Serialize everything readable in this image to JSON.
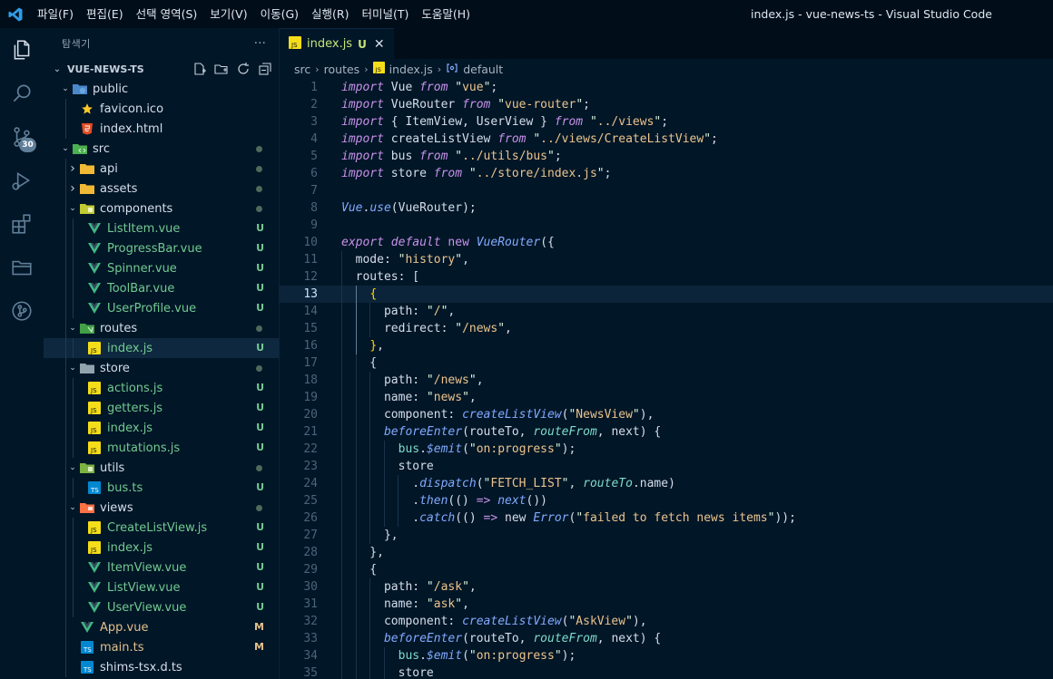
{
  "titlebar": {
    "menu": [
      "파일(F)",
      "편집(E)",
      "선택 영역(S)",
      "보기(V)",
      "이동(G)",
      "실행(R)",
      "터미널(T)",
      "도움말(H)"
    ],
    "window_title": "index.js - vue-news-ts - Visual Studio Code"
  },
  "activity": {
    "scm_badge": "30"
  },
  "explorer": {
    "header": "탐색기",
    "more": "···",
    "root": "VUE-NEWS-TS",
    "items": [
      {
        "label": "public",
        "depth": 1,
        "kind": "folder-open",
        "icon": "folder-public-icon",
        "status": "",
        "dot": false
      },
      {
        "label": "favicon.ico",
        "depth": 2,
        "kind": "file",
        "icon": "star-icon",
        "status": "",
        "dot": false
      },
      {
        "label": "index.html",
        "depth": 2,
        "kind": "file",
        "icon": "html-file-icon",
        "status": "",
        "dot": false
      },
      {
        "label": "src",
        "depth": 1,
        "kind": "folder-open",
        "icon": "folder-src-icon",
        "status": "",
        "dot": true
      },
      {
        "label": "api",
        "depth": 2,
        "kind": "folder-closed",
        "icon": "folder-icon",
        "status": "",
        "dot": true
      },
      {
        "label": "assets",
        "depth": 2,
        "kind": "folder-closed",
        "icon": "folder-icon",
        "status": "",
        "dot": true
      },
      {
        "label": "components",
        "depth": 2,
        "kind": "folder-open",
        "icon": "folder-components-icon",
        "status": "",
        "dot": true
      },
      {
        "label": "ListItem.vue",
        "depth": 3,
        "kind": "file",
        "icon": "vue-file-icon",
        "status": "U",
        "dot": false
      },
      {
        "label": "ProgressBar.vue",
        "depth": 3,
        "kind": "file",
        "icon": "vue-file-icon",
        "status": "U",
        "dot": false
      },
      {
        "label": "Spinner.vue",
        "depth": 3,
        "kind": "file",
        "icon": "vue-file-icon",
        "status": "U",
        "dot": false
      },
      {
        "label": "ToolBar.vue",
        "depth": 3,
        "kind": "file",
        "icon": "vue-file-icon",
        "status": "U",
        "dot": false
      },
      {
        "label": "UserProfile.vue",
        "depth": 3,
        "kind": "file",
        "icon": "vue-file-icon",
        "status": "U",
        "dot": false
      },
      {
        "label": "routes",
        "depth": 2,
        "kind": "folder-open",
        "icon": "folder-routes-icon",
        "status": "",
        "dot": true
      },
      {
        "label": "index.js",
        "depth": 3,
        "kind": "file",
        "icon": "js-file-icon",
        "status": "U",
        "dot": false,
        "active": true
      },
      {
        "label": "store",
        "depth": 2,
        "kind": "folder-open",
        "icon": "folder-store-icon",
        "status": "",
        "dot": true
      },
      {
        "label": "actions.js",
        "depth": 3,
        "kind": "file",
        "icon": "js-file-icon",
        "status": "U",
        "dot": false
      },
      {
        "label": "getters.js",
        "depth": 3,
        "kind": "file",
        "icon": "js-file-icon",
        "status": "U",
        "dot": false
      },
      {
        "label": "index.js",
        "depth": 3,
        "kind": "file",
        "icon": "js-file-icon",
        "status": "U",
        "dot": false
      },
      {
        "label": "mutations.js",
        "depth": 3,
        "kind": "file",
        "icon": "js-file-icon",
        "status": "U",
        "dot": false
      },
      {
        "label": "utils",
        "depth": 2,
        "kind": "folder-open",
        "icon": "folder-utils-icon",
        "status": "",
        "dot": true
      },
      {
        "label": "bus.ts",
        "depth": 3,
        "kind": "file",
        "icon": "ts-file-icon",
        "status": "U",
        "dot": false
      },
      {
        "label": "views",
        "depth": 2,
        "kind": "folder-open",
        "icon": "folder-views-icon",
        "status": "",
        "dot": true
      },
      {
        "label": "CreateListView.js",
        "depth": 3,
        "kind": "file",
        "icon": "js-file-icon",
        "status": "U",
        "dot": false
      },
      {
        "label": "index.js",
        "depth": 3,
        "kind": "file",
        "icon": "js-file-icon",
        "status": "U",
        "dot": false
      },
      {
        "label": "ItemView.vue",
        "depth": 3,
        "kind": "file",
        "icon": "vue-file-icon",
        "status": "U",
        "dot": false
      },
      {
        "label": "ListView.vue",
        "depth": 3,
        "kind": "file",
        "icon": "vue-file-icon",
        "status": "U",
        "dot": false
      },
      {
        "label": "UserView.vue",
        "depth": 3,
        "kind": "file",
        "icon": "vue-file-icon",
        "status": "U",
        "dot": false
      },
      {
        "label": "App.vue",
        "depth": 2,
        "kind": "file",
        "icon": "vue-file-icon",
        "status": "M",
        "dot": false
      },
      {
        "label": "main.ts",
        "depth": 2,
        "kind": "file",
        "icon": "ts-file-icon",
        "status": "M",
        "dot": false
      },
      {
        "label": "shims-tsx.d.ts",
        "depth": 2,
        "kind": "file",
        "icon": "ts-file-icon",
        "status": "",
        "dot": false
      }
    ]
  },
  "editor": {
    "tab": {
      "label": "index.js",
      "status": "U",
      "close": "✕"
    },
    "breadcrumb": [
      "src",
      "routes",
      "index.js",
      "default"
    ],
    "current_line": 13,
    "lines": [
      [
        [
          "k",
          "import"
        ],
        [
          "v",
          " Vue "
        ],
        [
          "k",
          "from"
        ],
        [
          "v",
          " "
        ],
        [
          "q",
          "\""
        ],
        [
          "s",
          "vue"
        ],
        [
          "q",
          "\""
        ],
        [
          "v",
          ";"
        ]
      ],
      [
        [
          "k",
          "import"
        ],
        [
          "v",
          " VueRouter "
        ],
        [
          "k",
          "from"
        ],
        [
          "v",
          " "
        ],
        [
          "q",
          "\""
        ],
        [
          "s",
          "vue-router"
        ],
        [
          "q",
          "\""
        ],
        [
          "v",
          ";"
        ]
      ],
      [
        [
          "k",
          "import"
        ],
        [
          "v",
          " { ItemView, UserView } "
        ],
        [
          "k",
          "from"
        ],
        [
          "v",
          " "
        ],
        [
          "q",
          "\""
        ],
        [
          "s",
          "../views"
        ],
        [
          "q",
          "\""
        ],
        [
          "v",
          ";"
        ]
      ],
      [
        [
          "k",
          "import"
        ],
        [
          "v",
          " createListView "
        ],
        [
          "k",
          "from"
        ],
        [
          "v",
          " "
        ],
        [
          "q",
          "\""
        ],
        [
          "s",
          "../views/CreateListView"
        ],
        [
          "q",
          "\""
        ],
        [
          "v",
          ";"
        ]
      ],
      [
        [
          "k",
          "import"
        ],
        [
          "v",
          " bus "
        ],
        [
          "k",
          "from"
        ],
        [
          "v",
          " "
        ],
        [
          "q",
          "\""
        ],
        [
          "s",
          "../utils/bus"
        ],
        [
          "q",
          "\""
        ],
        [
          "v",
          ";"
        ]
      ],
      [
        [
          "k",
          "import"
        ],
        [
          "v",
          " store "
        ],
        [
          "k",
          "from"
        ],
        [
          "v",
          " "
        ],
        [
          "q",
          "\""
        ],
        [
          "s",
          "../store/index.js"
        ],
        [
          "q",
          "\""
        ],
        [
          "v",
          ";"
        ]
      ],
      [],
      [
        [
          "it",
          "Vue"
        ],
        [
          "v",
          "."
        ],
        [
          "f",
          "use"
        ],
        [
          "v",
          "(VueRouter);"
        ]
      ],
      [],
      [
        [
          "k",
          "export"
        ],
        [
          "v",
          " "
        ],
        [
          "k",
          "default"
        ],
        [
          "v",
          " "
        ],
        [
          "kk",
          "new"
        ],
        [
          "v",
          " "
        ],
        [
          "f",
          "VueRouter"
        ],
        [
          "v",
          "({"
        ]
      ],
      [
        [
          "v",
          "  mode: "
        ],
        [
          "q",
          "\""
        ],
        [
          "s",
          "history"
        ],
        [
          "q",
          "\""
        ],
        [
          "v",
          ","
        ]
      ],
      [
        [
          "v",
          "  routes: ["
        ]
      ],
      [
        [
          "v",
          "    "
        ],
        [
          "b",
          "{"
        ]
      ],
      [
        [
          "v",
          "      path: "
        ],
        [
          "q",
          "\""
        ],
        [
          "s",
          "/"
        ],
        [
          "q",
          "\""
        ],
        [
          "v",
          ","
        ]
      ],
      [
        [
          "v",
          "      redirect: "
        ],
        [
          "q",
          "\""
        ],
        [
          "s",
          "/news"
        ],
        [
          "q",
          "\""
        ],
        [
          "v",
          ","
        ]
      ],
      [
        [
          "v",
          "    "
        ],
        [
          "b",
          "}"
        ],
        [
          "v",
          ","
        ]
      ],
      [
        [
          "v",
          "    {"
        ]
      ],
      [
        [
          "v",
          "      path: "
        ],
        [
          "q",
          "\""
        ],
        [
          "s",
          "/news"
        ],
        [
          "q",
          "\""
        ],
        [
          "v",
          ","
        ]
      ],
      [
        [
          "v",
          "      name: "
        ],
        [
          "q",
          "\""
        ],
        [
          "s",
          "news"
        ],
        [
          "q",
          "\""
        ],
        [
          "v",
          ","
        ]
      ],
      [
        [
          "v",
          "      component: "
        ],
        [
          "f",
          "createListView"
        ],
        [
          "v",
          "("
        ],
        [
          "q",
          "\""
        ],
        [
          "s",
          "NewsView"
        ],
        [
          "q",
          "\""
        ],
        [
          "v",
          "),"
        ]
      ],
      [
        [
          "v",
          "      "
        ],
        [
          "f",
          "beforeEnter"
        ],
        [
          "v",
          "(routeTo, "
        ],
        [
          "vi",
          "routeFrom"
        ],
        [
          "v",
          ", next) {"
        ]
      ],
      [
        [
          "v",
          "        "
        ],
        [
          "p",
          "bus"
        ],
        [
          "v",
          "."
        ],
        [
          "f",
          "$emit"
        ],
        [
          "v",
          "("
        ],
        [
          "q",
          "\""
        ],
        [
          "s",
          "on:progress"
        ],
        [
          "q",
          "\""
        ],
        [
          "v",
          ");"
        ]
      ],
      [
        [
          "v",
          "        store"
        ]
      ],
      [
        [
          "v",
          "          ."
        ],
        [
          "f",
          "dispatch"
        ],
        [
          "v",
          "("
        ],
        [
          "q",
          "\""
        ],
        [
          "s",
          "FETCH_LIST"
        ],
        [
          "q",
          "\""
        ],
        [
          "v",
          ", "
        ],
        [
          "vi",
          "routeTo"
        ],
        [
          "v",
          ".name)"
        ]
      ],
      [
        [
          "v",
          "          ."
        ],
        [
          "f",
          "then"
        ],
        [
          "v",
          "(() "
        ],
        [
          "kk",
          "=>"
        ],
        [
          "v",
          " "
        ],
        [
          "f",
          "next"
        ],
        [
          "v",
          "())"
        ]
      ],
      [
        [
          "v",
          "          ."
        ],
        [
          "f",
          "catch"
        ],
        [
          "v",
          "(() "
        ],
        [
          "kk",
          "=>"
        ],
        [
          "v",
          " "
        ],
        [
          "v",
          "new "
        ],
        [
          "f",
          "Error"
        ],
        [
          "v",
          "("
        ],
        [
          "q",
          "\""
        ],
        [
          "s",
          "failed to fetch news items"
        ],
        [
          "q",
          "\""
        ],
        [
          "v",
          "));"
        ]
      ],
      [
        [
          "v",
          "      },"
        ]
      ],
      [
        [
          "v",
          "    },"
        ]
      ],
      [
        [
          "v",
          "    {"
        ]
      ],
      [
        [
          "v",
          "      path: "
        ],
        [
          "q",
          "\""
        ],
        [
          "s",
          "/ask"
        ],
        [
          "q",
          "\""
        ],
        [
          "v",
          ","
        ]
      ],
      [
        [
          "v",
          "      name: "
        ],
        [
          "q",
          "\""
        ],
        [
          "s",
          "ask"
        ],
        [
          "q",
          "\""
        ],
        [
          "v",
          ","
        ]
      ],
      [
        [
          "v",
          "      component: "
        ],
        [
          "f",
          "createListView"
        ],
        [
          "v",
          "("
        ],
        [
          "q",
          "\""
        ],
        [
          "s",
          "AskView"
        ],
        [
          "q",
          "\""
        ],
        [
          "v",
          "),"
        ]
      ],
      [
        [
          "v",
          "      "
        ],
        [
          "f",
          "beforeEnter"
        ],
        [
          "v",
          "(routeTo, "
        ],
        [
          "vi",
          "routeFrom"
        ],
        [
          "v",
          ", next) {"
        ]
      ],
      [
        [
          "v",
          "        "
        ],
        [
          "p",
          "bus"
        ],
        [
          "v",
          "."
        ],
        [
          "f",
          "$emit"
        ],
        [
          "v",
          "("
        ],
        [
          "q",
          "\""
        ],
        [
          "s",
          "on:progress"
        ],
        [
          "q",
          "\""
        ],
        [
          "v",
          ");"
        ]
      ],
      [
        [
          "v",
          "        store"
        ]
      ]
    ]
  },
  "colors": {
    "accent": "#c5e478",
    "untracked": "#73c991",
    "modified": "#e2c08d",
    "background": "#011627"
  }
}
